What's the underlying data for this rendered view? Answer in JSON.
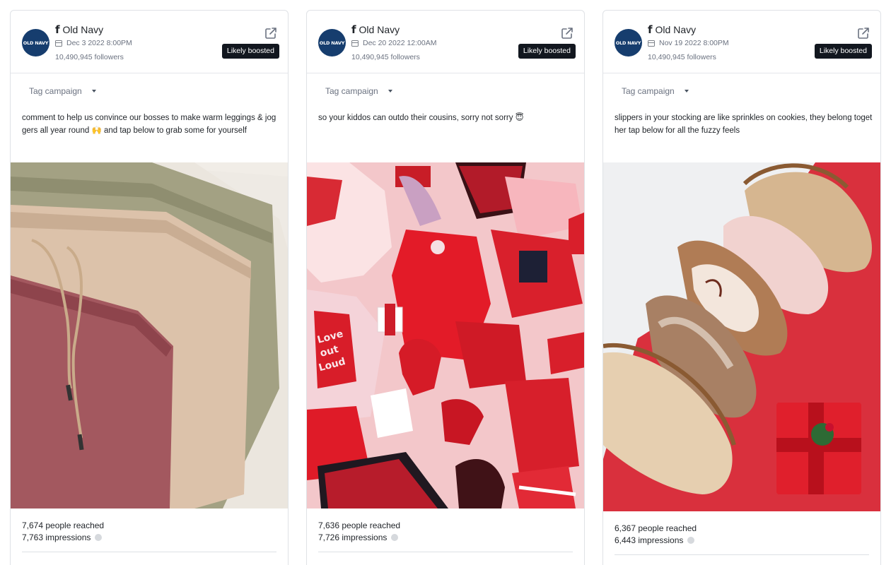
{
  "cards": [
    {
      "brand": "Old Navy",
      "logo_text": "OLD NAVY",
      "date": "Dec 3 2022 8:00PM",
      "followers": "10,490,945 followers",
      "badge": "Likely boosted",
      "tag_label": "Tag campaign",
      "caption": "comment to help us convince our bosses to make warm leggings & joggers all year round 🙌 and tap below to grab some for yourself",
      "reach": "7,674 people reached",
      "impressions": "7,763 impressions"
    },
    {
      "brand": "Old Navy",
      "logo_text": "OLD NAVY",
      "date": "Dec 20 2022 12:00AM",
      "followers": "10,490,945 followers",
      "badge": "Likely boosted",
      "tag_label": "Tag campaign",
      "caption": "so your kiddos can outdo their cousins, sorry not sorry 😇",
      "reach": "7,636 people reached",
      "impressions": "7,726 impressions"
    },
    {
      "brand": "Old Navy",
      "logo_text": "OLD NAVY",
      "date": "Nov 19 2022 8:00PM",
      "followers": "10,490,945 followers",
      "badge": "Likely boosted",
      "tag_label": "Tag campaign",
      "caption": "slippers in your stocking are like sprinkles on cookies, they belong together tap below for all the fuzzy feels",
      "reach": "6,367 people reached",
      "impressions": "6,443 impressions"
    }
  ],
  "icons": {
    "brand": "facebook-icon",
    "date": "calendar-icon",
    "open": "external-link-icon",
    "dropdown": "caret-down-icon",
    "info": "info-icon"
  },
  "colors": {
    "badge_bg": "#12171f",
    "logo_bg": "#163d6e",
    "border": "#dfe2e6"
  }
}
